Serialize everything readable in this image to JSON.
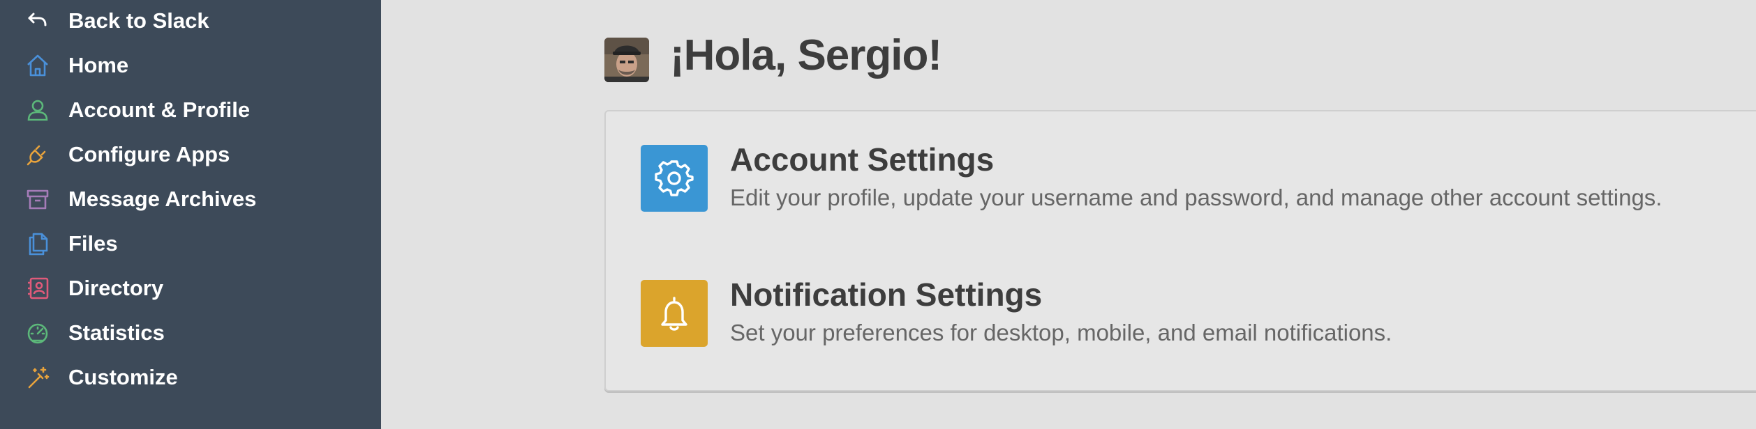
{
  "sidebar": {
    "items": [
      {
        "label": "Back to Slack",
        "icon": "back-arrow-icon",
        "color": "#ffffff"
      },
      {
        "label": "Home",
        "icon": "home-icon",
        "color": "#4a90d9"
      },
      {
        "label": "Account & Profile",
        "icon": "user-icon",
        "color": "#5cb87a"
      },
      {
        "label": "Configure Apps",
        "icon": "plug-icon",
        "color": "#e8a33c"
      },
      {
        "label": "Message Archives",
        "icon": "archive-icon",
        "color": "#a57cb8"
      },
      {
        "label": "Files",
        "icon": "files-icon",
        "color": "#4a90d9"
      },
      {
        "label": "Directory",
        "icon": "directory-icon",
        "color": "#e05a7a"
      },
      {
        "label": "Statistics",
        "icon": "gauge-icon",
        "color": "#5cb87a"
      },
      {
        "label": "Customize",
        "icon": "magic-wand-icon",
        "color": "#e8a33c"
      }
    ]
  },
  "main": {
    "greeting": "¡Hola, Sergio!",
    "settings": [
      {
        "title": "Account Settings",
        "description": "Edit your profile, update your username and password, and manage other account settings.",
        "icon": "gear-icon",
        "color": "#3a96d4"
      },
      {
        "title": "Notification Settings",
        "description": "Set your preferences for desktop, mobile, and email notifications.",
        "icon": "bell-icon",
        "color": "#dba42c"
      }
    ]
  }
}
